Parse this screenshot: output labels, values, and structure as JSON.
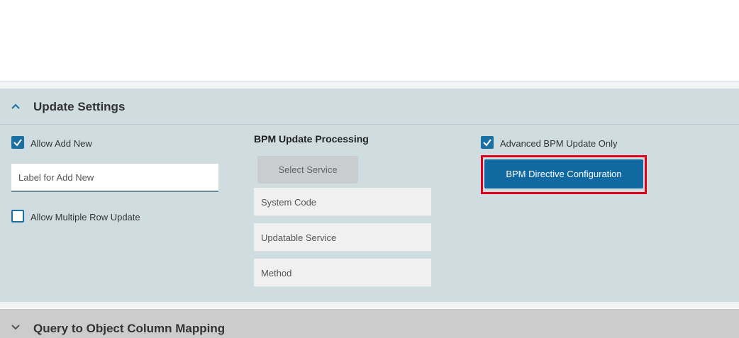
{
  "update_settings": {
    "title": "Update Settings",
    "allow_add_new": {
      "label": "Allow Add New",
      "checked": true
    },
    "label_for_add_new": {
      "placeholder": "Label for Add New",
      "value": ""
    },
    "allow_multiple_row_update": {
      "label": "Allow Multiple Row Update",
      "checked": false
    },
    "bpm_update_processing": {
      "heading": "BPM Update Processing",
      "select_service_label": "Select Service",
      "fields": [
        {
          "label": "System Code"
        },
        {
          "label": "Updatable Service"
        },
        {
          "label": "Method"
        }
      ]
    },
    "advanced_bpm_update_only": {
      "label": "Advanced BPM Update Only",
      "checked": true
    },
    "bpm_directive_button_label": "BPM Directive Configuration"
  },
  "query_mapping": {
    "title": "Query to Object Column Mapping"
  },
  "colors": {
    "panel_bg": "#cfdde1",
    "accent": "#1a6fa3",
    "primary_button": "#1169a1",
    "highlight": "#e0001b",
    "collapsed_panel_bg": "#cccccc"
  }
}
